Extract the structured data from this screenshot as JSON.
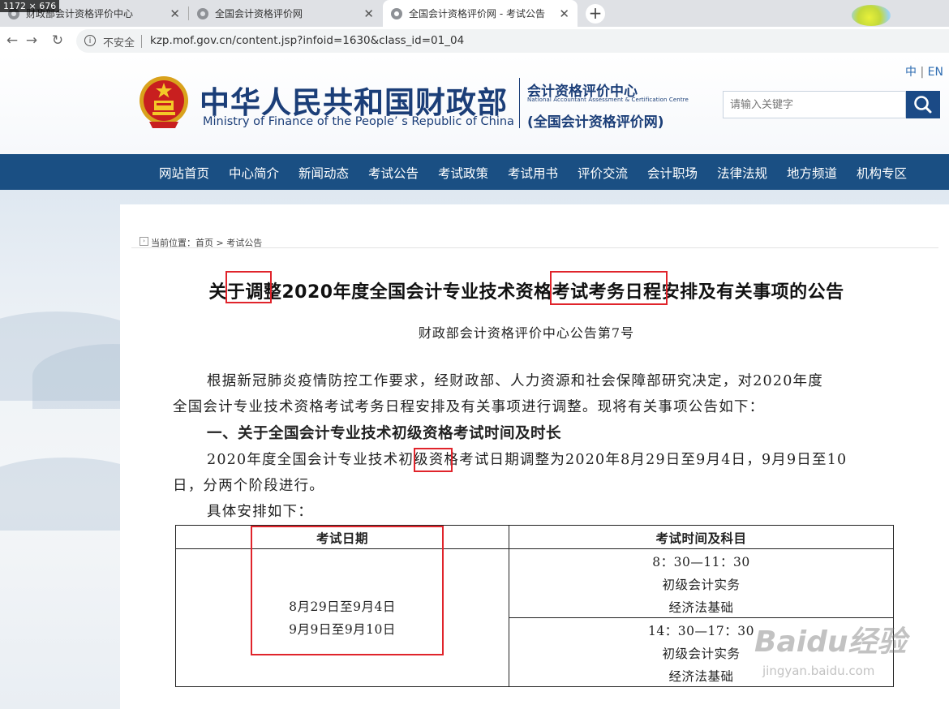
{
  "browser": {
    "dimensions_badge": "1172 × 676",
    "tabs": [
      {
        "title": "财政部会计资格评价中心",
        "active": false
      },
      {
        "title": "全国会计资格评价网",
        "active": false
      },
      {
        "title": "全国会计资格评价网 - 考试公告",
        "active": true
      }
    ],
    "security_label": "不安全",
    "url": "kzp.mof.gov.cn/content.jsp?infoid=1630&class_id=01_04",
    "icons": [
      "back-icon",
      "forward-icon",
      "reload-icon",
      "info-icon",
      "close-icon",
      "plus-icon"
    ]
  },
  "header": {
    "site_name_cn": "中华人民共和国财政部",
    "site_name_en": "Ministry of Finance of the People’ s Republic of China",
    "center_name_cn": "会计资格评价中心",
    "center_name_en": "National Accountant Assessment & Certification Centre",
    "center_subtitle": "(全国会计资格评价网)",
    "lang_cn": "中",
    "lang_sep": "|",
    "lang_en": "EN",
    "search_placeholder": "请输入关键字"
  },
  "nav": {
    "items": [
      "网站首页",
      "中心简介",
      "新闻动态",
      "考试公告",
      "考试政策",
      "考试用书",
      "评价交流",
      "会计职场",
      "法律法规",
      "地方频道",
      "机构专区"
    ]
  },
  "breadcrumb": {
    "prefix": "当前位置：",
    "home": "首页",
    "sep": " > ",
    "current": "考试公告"
  },
  "article": {
    "title": "关于调整2020年度全国会计专业技术资格考试考务日程安排及有关事项的公告",
    "subtitle": "财政部会计资格评价中心公告第7号",
    "para1_line1": "根据新冠肺炎疫情防控工作要求，经财政部、人力资源和社会保障部研究决定，对2020年度",
    "para1_line2": "全国会计专业技术资格考试考务日程安排及有关事项进行调整。现将有关事项公告如下：",
    "section1_heading": "一、关于全国会计专业技术初级资格考试时间及时长",
    "para2_line1": "2020年度全国会计专业技术初级资格考试日期调整为2020年8月29日至9月4日，9月9日至10",
    "para2_line2": "日，分两个阶段进行。",
    "para3": "具体安排如下："
  },
  "schedule_table": {
    "headers": [
      "考试日期",
      "考试时间及科目"
    ],
    "dates": [
      "8月29日至9月4日",
      "9月9日至9月10日"
    ],
    "sessions": [
      {
        "time": "8：30—11：30",
        "subjects": [
          "初级会计实务",
          "经济法基础"
        ]
      },
      {
        "time": "14：30—17：30",
        "subjects": [
          "初级会计实务",
          "经济法基础"
        ]
      }
    ]
  },
  "watermark": {
    "main": "Baidu经验",
    "sub": "jingyan.baidu.com"
  },
  "colors": {
    "nav_bg": "#1a4f83",
    "brand_blue": "#1b3e78",
    "highlight_red": "#e0242b"
  }
}
